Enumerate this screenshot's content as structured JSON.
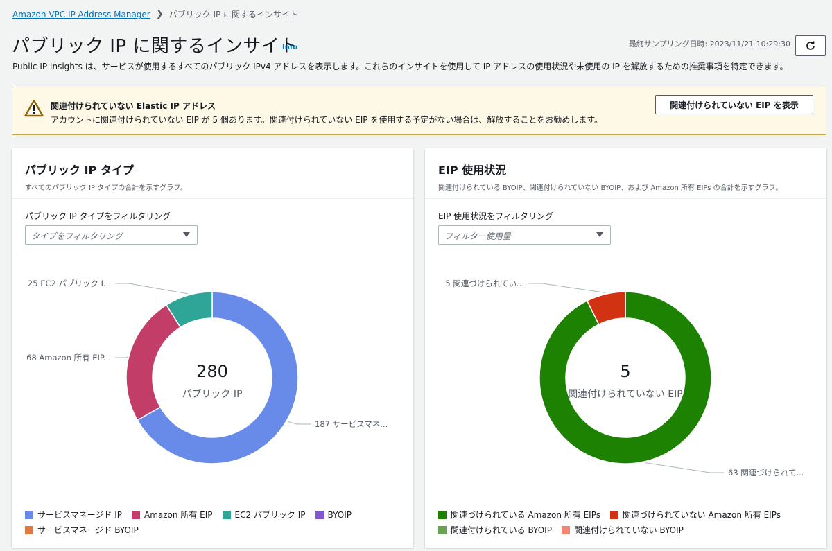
{
  "breadcrumb": {
    "root": "Amazon VPC IP Address Manager",
    "current": "パブリック IP に関するインサイト"
  },
  "header": {
    "title": "パブリック IP に関するインサイト",
    "info": "Info",
    "sampling": "最終サンプリング日時: 2023/11/21 10:29:30",
    "description": "Public IP Insights は、サービスが使用するすべてのパブリック IPv4 アドレスを表示します。これらのインサイトを使用して IP アドレスの使用状況や未使用の IP を解放するための推奨事項を特定できます。"
  },
  "alert": {
    "title": "関連付けられていない Elastic IP アドレス",
    "body": "アカウントに関連付けられていない EIP が 5 個あります。関連付けられていない EIP を使用する予定がない場合は、解放することをお勧めします。",
    "button": "関連付けられていない EIP を表示"
  },
  "left_panel": {
    "title": "パブリック IP タイプ",
    "subtitle": "すべてのパブリック IP タイプの合計を示すグラフ。",
    "filter_label": "パブリック IP タイプをフィルタリング",
    "filter_placeholder": "タイプをフィルタリング",
    "center_value": "280",
    "center_label": "パブリック IP",
    "callouts": [
      "187 サービスマネ...",
      "68 Amazon 所有 EIP...",
      "25 EC2 パブリック I..."
    ]
  },
  "right_panel": {
    "title": "EIP 使用状況",
    "subtitle": "関連付けられている BYOIP、関連付けられていない BYOIP、および Amazon 所有 EIPs の合計を示すグラフ。",
    "filter_label": "EIP 使用状況をフィルタリング",
    "filter_placeholder": "フィルター使用量",
    "center_value": "5",
    "center_label": "関連付けられていない EIP",
    "callouts": [
      "63 関連づけられて...",
      "5 関連づけられてい..."
    ]
  },
  "chart_data": [
    {
      "type": "pie",
      "categories": [
        "サービスマネージド IP",
        "Amazon 所有 EIP",
        "EC2 パブリック IP",
        "BYOIP",
        "サービスマネージド BYOIP"
      ],
      "values": [
        187,
        68,
        25,
        0,
        0
      ],
      "colors": [
        "#688ae8",
        "#c33d69",
        "#2ea597",
        "#8456ce",
        "#e07941"
      ],
      "legend": "bottom"
    },
    {
      "type": "pie",
      "categories": [
        "関連づけられている Amazon 所有 EIPs",
        "関連づけられていない Amazon 所有 EIPs",
        "関連付けられている BYOIP",
        "関連付けられていない BYOIP"
      ],
      "values": [
        63,
        5,
        0,
        0
      ],
      "colors": [
        "#1d8102",
        "#d13212",
        "#67a353",
        "#f28773"
      ],
      "legend": "bottom"
    }
  ]
}
